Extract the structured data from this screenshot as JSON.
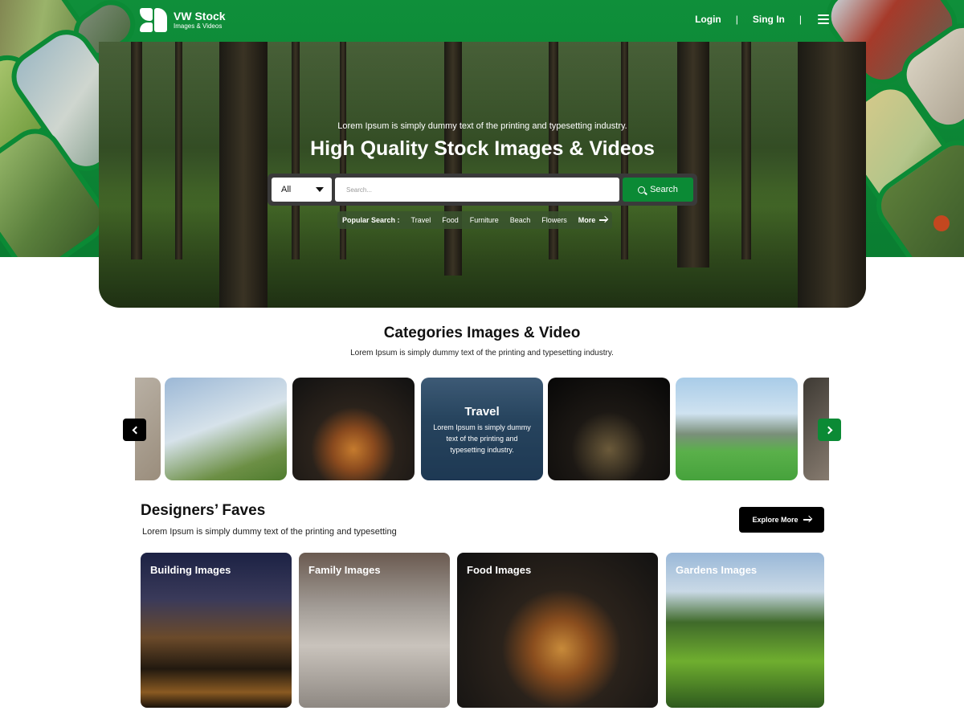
{
  "brand": {
    "title": "VW Stock",
    "subtitle": "Images & Videos"
  },
  "nav": {
    "login": "Login",
    "separator": "|",
    "signin": "Sing In"
  },
  "hero": {
    "tagline": "Lorem Ipsum is simply dummy text of the printing and typesetting industry.",
    "title": "High  Quality Stock Images & Videos",
    "search": {
      "select_value": "All",
      "placeholder": "Search...",
      "button_label": "Search"
    },
    "popular": {
      "label": "Popular Search :",
      "tags": [
        "Travel",
        "Food",
        "Furniture",
        "Beach",
        "Flowers"
      ],
      "more": "More"
    }
  },
  "categories": {
    "title": "Categories Images & Video",
    "subtitle": "Lorem Ipsum is simply dummy text of the printing and typesetting industry.",
    "featured": {
      "title": "Travel",
      "description": "Lorem Ipsum is simply dummy text of the printing and typesetting industry."
    }
  },
  "faves": {
    "title": "Designers’ Faves",
    "subtitle": "Lorem Ipsum is simply dummy text of the printing and typesetting",
    "explore": "Explore More",
    "items": [
      {
        "label": "Building Images"
      },
      {
        "label": "Family Images"
      },
      {
        "label": "Food Images"
      },
      {
        "label": "Gardens Images"
      }
    ]
  },
  "colors": {
    "brand_green": "#0b8a35",
    "dark": "#000000",
    "white": "#ffffff"
  }
}
